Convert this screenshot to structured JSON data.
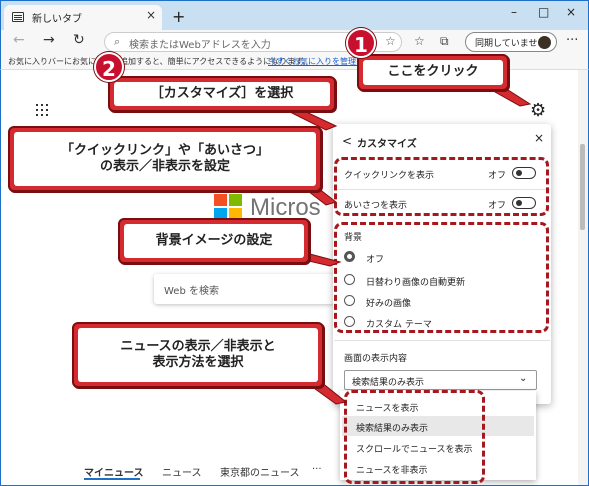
{
  "browser": {
    "tab_title": "新しいタブ",
    "tab_close": "×",
    "new_tab": "+",
    "window_min": "–",
    "window_max": "□",
    "window_close": "×",
    "back": "←",
    "forward": "→",
    "refresh": "↻",
    "address_placeholder": "検索またはWebアドレスを入力",
    "star": "☆",
    "profile_label": "同期していません",
    "menu": "···",
    "favorites_text": "お気に入りバーにお気に入りを追加すると、簡単にアクセスできるようになります。",
    "favorites_link": "今すぐお気に入りを管理する"
  },
  "page": {
    "ms_text": "Micros",
    "web_search_placeholder": "Web を検索",
    "news_tabs": [
      "マイニュース",
      "ニュース",
      "東京都のニュース",
      "···"
    ]
  },
  "panel": {
    "title": "カスタマイズ",
    "back": "<",
    "close": "×",
    "toggles": [
      {
        "label": "クイックリンクを表示",
        "state": "オフ"
      },
      {
        "label": "あいさつを表示",
        "state": "オフ"
      }
    ],
    "background_heading": "背景",
    "background_options": [
      "オフ",
      "日替わり画像の自動更新",
      "好みの画像",
      "カスタム テーマ"
    ],
    "background_selected": "オフ",
    "content_heading": "画面の表示内容",
    "content_selected": "検索結果のみ表示",
    "content_options": [
      "ニュースを表示",
      "検索結果のみ表示",
      "スクロールでニュースを表示",
      "ニュースを非表示"
    ]
  },
  "annotations": {
    "badge1": "1",
    "badge2": "2",
    "callout_click": "ここをクリック",
    "callout_customize": "［カスタマイズ］を選択",
    "callout_quicklink_line1": "「クイックリンク」や「あいさつ」",
    "callout_quicklink_line2": "の表示／非表示を設定",
    "callout_bg": "背景イメージの設定",
    "callout_news_line1": "ニュースの表示／非表示と",
    "callout_news_line2": "表示方法を選択",
    "accent_color": "#d52a2f"
  }
}
